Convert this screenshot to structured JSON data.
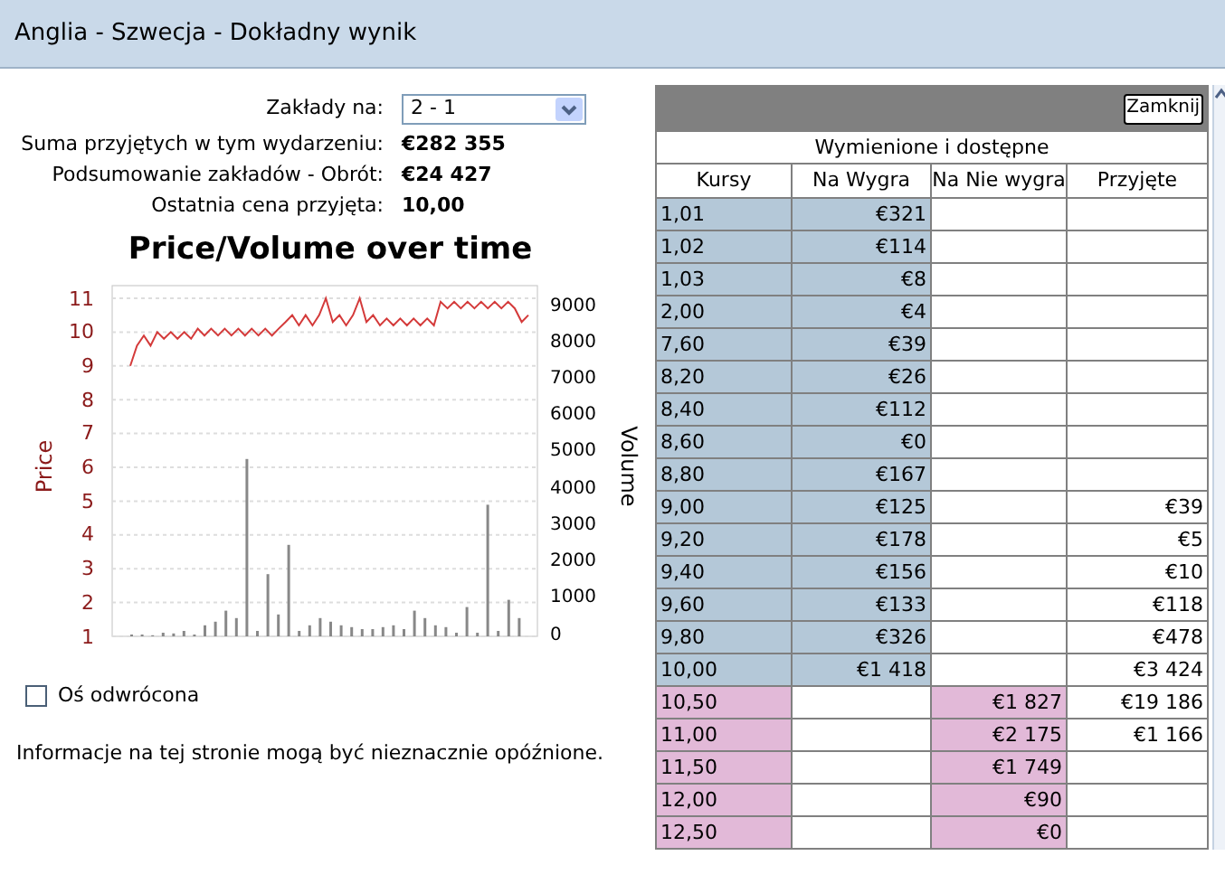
{
  "window": {
    "title": "Anglia - Szwecja - Dokładny wynik"
  },
  "bet_on": {
    "label": "Zakłady na:",
    "value": "2 - 1"
  },
  "summary": [
    {
      "label": "Suma przyjętych w tym wydarzeniu:",
      "value": "€282 355"
    },
    {
      "label": "Podsumowanie zakładów - Obrót:",
      "value": "€24 427"
    },
    {
      "label": "Ostatnia cena przyjęta:",
      "value": "10,00"
    }
  ],
  "chart": {
    "title": "Price/Volume over time",
    "chart_data": {
      "type": "line",
      "ylabel": "Price",
      "yticks": [
        1,
        2,
        3,
        4,
        5,
        6,
        7,
        8,
        9,
        10,
        11
      ],
      "ylim": [
        1,
        11
      ],
      "grid": true,
      "series": [
        {
          "color": "#d43a3a",
          "values": [
            9,
            9.6,
            9.9,
            9.6,
            10,
            9.8,
            10,
            9.8,
            10,
            9.8,
            10.1,
            9.9,
            10.1,
            9.9,
            10.1,
            9.9,
            10.1,
            9.9,
            10.1,
            9.9,
            10.1,
            9.9,
            10.1,
            10.3,
            10.5,
            10.2,
            10.5,
            10.2,
            10.5,
            11,
            10.3,
            10.5,
            10.2,
            10.5,
            11,
            10.3,
            10.5,
            10.2,
            10.4,
            10.2,
            10.4,
            10.2,
            10.4,
            10.2,
            10.4,
            10.2,
            10.9,
            10.7,
            10.9,
            10.7,
            10.9,
            10.7,
            10.9,
            10.7,
            10.9,
            10.7,
            10.9,
            10.7,
            10.3,
            10.5
          ]
        }
      ]
    },
    "volume_axis": {
      "label": "Volume",
      "ticks": [
        "9000",
        "8000",
        "7000",
        "6000",
        "5000",
        "4000",
        "3000",
        "2000",
        "1000",
        "0"
      ]
    }
  },
  "reverse_axis": {
    "label": "Oś odwrócona",
    "checked": false
  },
  "notice": "Informacje na tej stronie mogą być nieznacznie opóźnione.",
  "table": {
    "close_button": "Zamknij",
    "caption": "Wymienione i dostępne",
    "columns": [
      "Kursy",
      "Na Wygra",
      "Na Nie wygra",
      "Przyjęte"
    ],
    "rows": [
      {
        "kind": "back",
        "odds": "1,01",
        "back": "€321",
        "lay": "",
        "matched": ""
      },
      {
        "kind": "back",
        "odds": "1,02",
        "back": "€114",
        "lay": "",
        "matched": ""
      },
      {
        "kind": "back",
        "odds": "1,03",
        "back": "€8",
        "lay": "",
        "matched": ""
      },
      {
        "kind": "back",
        "odds": "2,00",
        "back": "€4",
        "lay": "",
        "matched": ""
      },
      {
        "kind": "back",
        "odds": "7,60",
        "back": "€39",
        "lay": "",
        "matched": ""
      },
      {
        "kind": "back",
        "odds": "8,20",
        "back": "€26",
        "lay": "",
        "matched": ""
      },
      {
        "kind": "back",
        "odds": "8,40",
        "back": "€112",
        "lay": "",
        "matched": ""
      },
      {
        "kind": "back",
        "odds": "8,60",
        "back": "€0",
        "lay": "",
        "matched": ""
      },
      {
        "kind": "back",
        "odds": "8,80",
        "back": "€167",
        "lay": "",
        "matched": ""
      },
      {
        "kind": "back",
        "odds": "9,00",
        "back": "€125",
        "lay": "",
        "matched": "€39"
      },
      {
        "kind": "back",
        "odds": "9,20",
        "back": "€178",
        "lay": "",
        "matched": "€5"
      },
      {
        "kind": "back",
        "odds": "9,40",
        "back": "€156",
        "lay": "",
        "matched": "€10"
      },
      {
        "kind": "back",
        "odds": "9,60",
        "back": "€133",
        "lay": "",
        "matched": "€118"
      },
      {
        "kind": "back",
        "odds": "9,80",
        "back": "€326",
        "lay": "",
        "matched": "€478"
      },
      {
        "kind": "back",
        "odds": "10,00",
        "back": "€1 418",
        "lay": "",
        "matched": "€3 424"
      },
      {
        "kind": "lay",
        "odds": "10,50",
        "back": "",
        "lay": "€1 827",
        "matched": "€19 186"
      },
      {
        "kind": "lay",
        "odds": "11,00",
        "back": "",
        "lay": "€2 175",
        "matched": "€1 166"
      },
      {
        "kind": "lay",
        "odds": "11,50",
        "back": "",
        "lay": "€1 749",
        "matched": ""
      },
      {
        "kind": "lay",
        "odds": "12,00",
        "back": "",
        "lay": "€90",
        "matched": ""
      },
      {
        "kind": "lay",
        "odds": "12,50",
        "back": "",
        "lay": "€0",
        "matched": ""
      }
    ]
  }
}
